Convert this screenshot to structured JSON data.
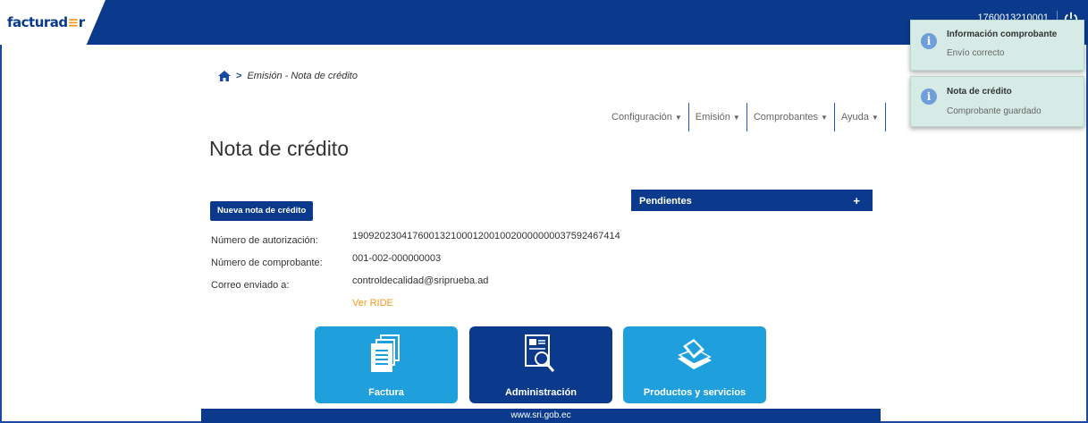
{
  "header": {
    "logo_main": "facturad",
    "logo_accent": "≡",
    "logo_end": "r",
    "user_id": "1760013210001",
    "accent_color": "#0b3a8c"
  },
  "breadcrumb": {
    "text": "Emisión - Nota de crédito"
  },
  "menu": [
    {
      "label": "Configuración"
    },
    {
      "label": "Emisión"
    },
    {
      "label": "Comprobantes"
    },
    {
      "label": "Ayuda"
    }
  ],
  "page": {
    "title": "Nota de crédito",
    "new_button": "Nueva nota de crédito"
  },
  "info": {
    "auth_label": "Número de autorización:",
    "auth_value": "1909202304176001321000120010020000000037592467414",
    "number_label": "Número de comprobante:",
    "number_value": "001-002-000000003",
    "email_label": "Correo enviado a:",
    "email_value": "controldecalidad@sriprueba.ad",
    "ride_link": "Ver RIDE"
  },
  "pendientes": {
    "label": "Pendientes",
    "plus": "+"
  },
  "tiles": [
    {
      "label": "Factura",
      "icon": "documents-icon"
    },
    {
      "label": "Administración",
      "icon": "admin-search-icon"
    },
    {
      "label": "Productos y servicios",
      "icon": "products-icon"
    }
  ],
  "footer": {
    "url": "www.sri.gob.ec"
  },
  "toasts": [
    {
      "title": "Información comprobante",
      "message": "Envío correcto"
    },
    {
      "title": "Nota de crédito",
      "message": "Comprobante guardado"
    }
  ]
}
